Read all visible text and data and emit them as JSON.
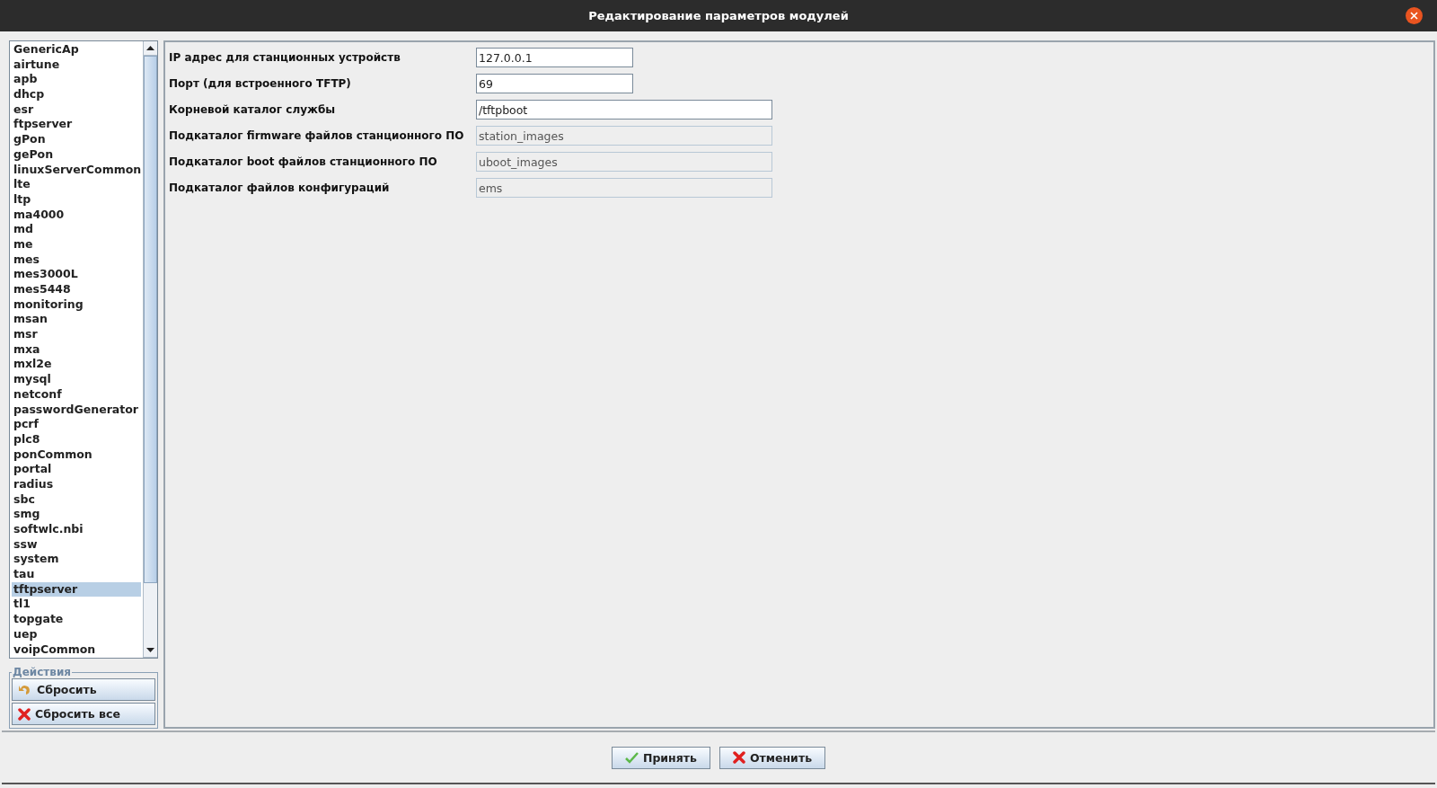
{
  "window": {
    "title": "Редактирование параметров модулей"
  },
  "modules": [
    {
      "label": "GenericAp",
      "selected": false
    },
    {
      "label": "airtune",
      "selected": false
    },
    {
      "label": "apb",
      "selected": false
    },
    {
      "label": "dhcp",
      "selected": false
    },
    {
      "label": "esr",
      "selected": false
    },
    {
      "label": "ftpserver",
      "selected": false
    },
    {
      "label": "gPon",
      "selected": false
    },
    {
      "label": "gePon",
      "selected": false
    },
    {
      "label": "linuxServerCommon",
      "selected": false
    },
    {
      "label": "lte",
      "selected": false
    },
    {
      "label": "ltp",
      "selected": false
    },
    {
      "label": "ma4000",
      "selected": false
    },
    {
      "label": "md",
      "selected": false
    },
    {
      "label": "me",
      "selected": false
    },
    {
      "label": "mes",
      "selected": false
    },
    {
      "label": "mes3000L",
      "selected": false
    },
    {
      "label": "mes5448",
      "selected": false
    },
    {
      "label": "monitoring",
      "selected": false
    },
    {
      "label": "msan",
      "selected": false
    },
    {
      "label": "msr",
      "selected": false
    },
    {
      "label": "mxa",
      "selected": false
    },
    {
      "label": "mxl2e",
      "selected": false
    },
    {
      "label": "mysql",
      "selected": false
    },
    {
      "label": "netconf",
      "selected": false
    },
    {
      "label": "passwordGenerator",
      "selected": false
    },
    {
      "label": "pcrf",
      "selected": false
    },
    {
      "label": "plc8",
      "selected": false
    },
    {
      "label": "ponCommon",
      "selected": false
    },
    {
      "label": "portal",
      "selected": false
    },
    {
      "label": "radius",
      "selected": false
    },
    {
      "label": "sbc",
      "selected": false
    },
    {
      "label": "smg",
      "selected": false
    },
    {
      "label": "softwlc.nbi",
      "selected": false
    },
    {
      "label": "ssw",
      "selected": false
    },
    {
      "label": "system",
      "selected": false
    },
    {
      "label": "tau",
      "selected": false
    },
    {
      "label": "tftpserver",
      "selected": true
    },
    {
      "label": "tl1",
      "selected": false
    },
    {
      "label": "topgate",
      "selected": false
    },
    {
      "label": "uep",
      "selected": false
    },
    {
      "label": "voipCommon",
      "selected": false
    }
  ],
  "actions": {
    "title": "Действия",
    "buttons": [
      {
        "label": "Сбросить",
        "kind": "undo"
      },
      {
        "label": "Сбросить все",
        "kind": "cross"
      }
    ]
  },
  "params": [
    {
      "label": "IP адрес для станционных устройств",
      "value": "127.0.0.1",
      "kind": "short",
      "disabled": false
    },
    {
      "label": "Порт (для встроенного TFTP)",
      "value": "69",
      "kind": "short",
      "disabled": false
    },
    {
      "label": "Корневой каталог службы",
      "value": "/tftpboot",
      "kind": "long",
      "disabled": false
    },
    {
      "label": "Подкаталог firmware файлов станционного ПО",
      "value": "station_images",
      "kind": "long",
      "disabled": true
    },
    {
      "label": "Подкаталог boot файлов станционного ПО",
      "value": "uboot_images",
      "kind": "long",
      "disabled": true
    },
    {
      "label": "Подкаталог файлов конфигураций",
      "value": "ems",
      "kind": "long",
      "disabled": true
    }
  ],
  "buttons": [
    {
      "label": "Принять",
      "kind": "check"
    },
    {
      "label": "Отменить",
      "kind": "cross"
    }
  ]
}
